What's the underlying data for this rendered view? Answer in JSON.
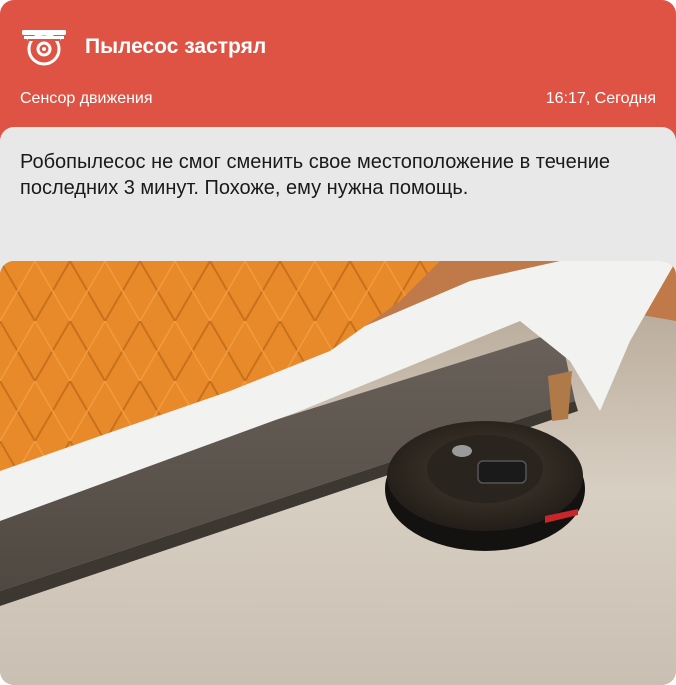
{
  "notification": {
    "title": "Пылесос застрял",
    "source": "Сенсор движения",
    "time": "16:17, Сегодня",
    "message": "Робопылесос не смог сменить свое местоположение в течение последних 3 минут. Похоже, ему нужна помощь.",
    "icon": "security-camera-icon",
    "accent_color": "#df5345",
    "photo_subject": "robot-vacuum-under-bed"
  }
}
